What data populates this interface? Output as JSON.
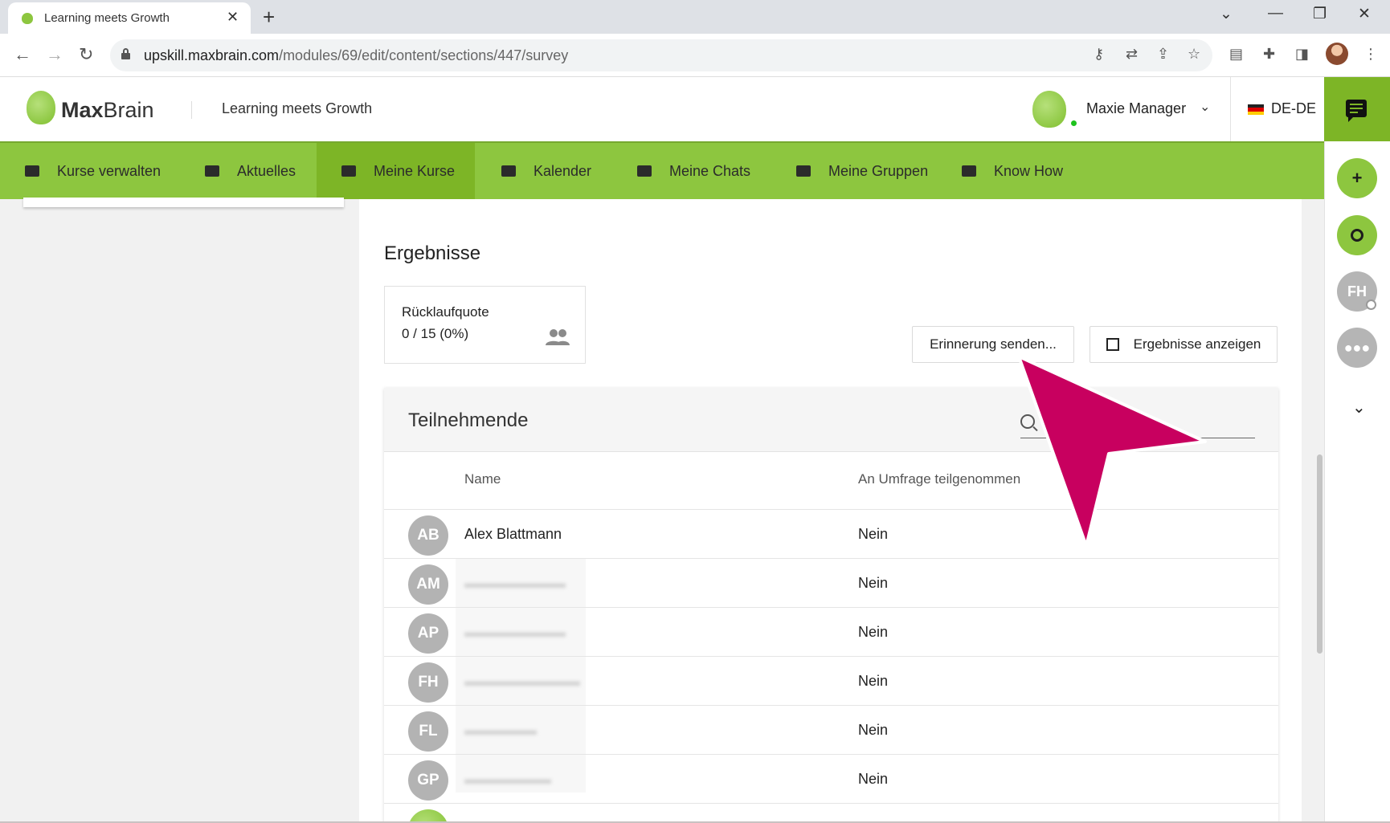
{
  "browser": {
    "tab_title": "Learning meets Growth",
    "url_host": "upskill.maxbrain.com",
    "url_path": "/modules/69/edit/content/sections/447/survey"
  },
  "header": {
    "logo_bold": "Max",
    "logo_light": "Brain",
    "app_title": "Learning meets Growth",
    "user_name": "Maxie Manager",
    "language": "DE-DE"
  },
  "nav": {
    "items": [
      {
        "label": "Kurse verwalten",
        "icon": "id-card-icon"
      },
      {
        "label": "Aktuelles",
        "icon": "library-icon"
      },
      {
        "label": "Meine Kurse",
        "icon": "graduation-cap-icon"
      },
      {
        "label": "Kalender",
        "icon": "calendar-icon"
      },
      {
        "label": "Meine Chats",
        "icon": "inbox-icon"
      },
      {
        "label": "Meine Gruppen",
        "icon": "group-card-icon"
      },
      {
        "label": "Know How",
        "icon": "book-icon"
      }
    ],
    "active": "Meine Kurse"
  },
  "rail": {
    "avatar_initials": "FH"
  },
  "results": {
    "title": "Ergebnisse",
    "response_rate_label": "Rücklaufquote",
    "response_rate_value": "0 / 15 (0%)",
    "reminder_button": "Erinnerung senden...",
    "show_results_button": "Ergebnisse anzeigen"
  },
  "participants": {
    "title": "Teilnehmende",
    "columns": [
      "Name",
      "An Umfrage teilgenommen"
    ],
    "rows": [
      {
        "initials": "AB",
        "name": "Alex Blattmann",
        "participated": "Nein"
      },
      {
        "initials": "AM",
        "name": "",
        "participated": "Nein"
      },
      {
        "initials": "AP",
        "name": "",
        "participated": "Nein"
      },
      {
        "initials": "FH",
        "name": "",
        "participated": "Nein"
      },
      {
        "initials": "FL",
        "name": "",
        "participated": "Nein"
      },
      {
        "initials": "GP",
        "name": "",
        "participated": "Nein"
      }
    ]
  },
  "colors": {
    "brand_green": "#8dc63f",
    "active_green": "#7db526",
    "pointer_magenta": "#c8005f"
  }
}
